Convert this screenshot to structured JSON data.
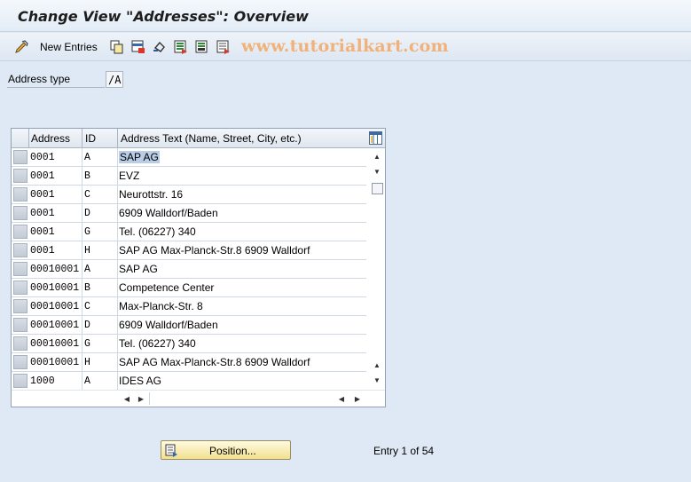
{
  "window": {
    "title": "Change View \"Addresses\": Overview"
  },
  "toolbar": {
    "new_entries_label": "New Entries",
    "icons": [
      "edit-toggle-icon",
      "copy-icon",
      "delete-icon",
      "undo-icon",
      "select-all-icon",
      "select-block-icon",
      "deselect-all-icon"
    ],
    "watermark": "www.tutorialkart.com"
  },
  "selection": {
    "label": "Address type",
    "value": "/A"
  },
  "table": {
    "headers": {
      "address": "Address",
      "id": "ID",
      "text": "Address Text (Name, Street, City, etc.)"
    },
    "rows": [
      {
        "address": "0001",
        "id": "A",
        "text": "SAP AG"
      },
      {
        "address": "0001",
        "id": "B",
        "text": "EVZ"
      },
      {
        "address": "0001",
        "id": "C",
        "text": "Neurottstr. 16"
      },
      {
        "address": "0001",
        "id": "D",
        "text": "6909   Walldorf/Baden"
      },
      {
        "address": "0001",
        "id": "G",
        "text": "Tel. (06227) 340"
      },
      {
        "address": "0001",
        "id": "H",
        "text": "SAP AG Max-Planck-Str.8 6909 Walldorf"
      },
      {
        "address": "00010001",
        "id": "A",
        "text": "SAP AG"
      },
      {
        "address": "00010001",
        "id": "B",
        "text": "Competence Center"
      },
      {
        "address": "00010001",
        "id": "C",
        "text": "Max-Planck-Str. 8"
      },
      {
        "address": "00010001",
        "id": "D",
        "text": "6909   Walldorf/Baden"
      },
      {
        "address": "00010001",
        "id": "G",
        "text": "Tel. (06227) 340"
      },
      {
        "address": "00010001",
        "id": "H",
        "text": "SAP AG Max-Planck-Str.8 6909 Walldorf"
      },
      {
        "address": "1000",
        "id": "A",
        "text": "IDES AG"
      }
    ]
  },
  "footer": {
    "position_label": "Position...",
    "entry_info": "Entry 1 of 54"
  },
  "colors": {
    "background": "#dfe9f5",
    "button_yellow": "#f2e08e",
    "selected_cell": "#b9cde6",
    "watermark": "#f0b27a"
  }
}
